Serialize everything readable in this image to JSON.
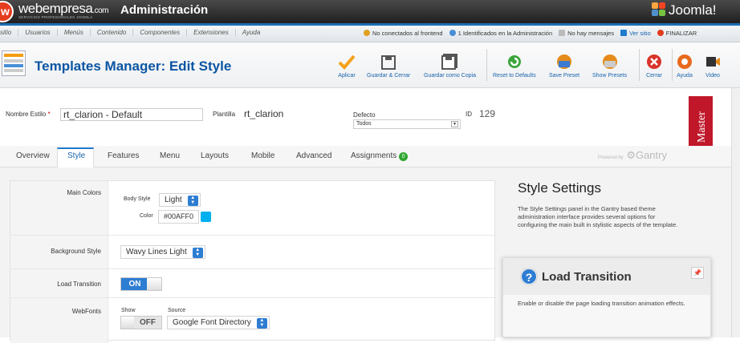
{
  "topbar": {
    "brand": "webempresa",
    "brand_suffix": ".com",
    "brand_sub": "SERVICIOS PROFESIONALES JOOMLA",
    "title": "Administración",
    "joomla": "Joomla!"
  },
  "menu": [
    "sitio",
    "Usuarios",
    "Menús",
    "Contenido",
    "Componentes",
    "Extensiones",
    "Ayuda"
  ],
  "status": {
    "frontend": "No conectados al frontend",
    "admin": "1 Identificados en la Administración",
    "messages": "No hay mensajes",
    "view_site": "Ver sitio",
    "logout": "FINALIZAR"
  },
  "toolbar": {
    "page_title": "Templates Manager: Edit Style",
    "buttons": [
      {
        "label": "Aplicar",
        "icon": "check-icon"
      },
      {
        "label": "Guardar & Cerrar",
        "icon": "save-icon"
      },
      {
        "label": "Guardar como Copia",
        "icon": "save-copy-icon"
      },
      {
        "label": "Reset to Defaults",
        "icon": "reset-icon"
      },
      {
        "label": "Save Preset",
        "icon": "save-preset-icon"
      },
      {
        "label": "Show Presets",
        "icon": "presets-icon"
      },
      {
        "label": "Cerrar",
        "icon": "close-icon"
      },
      {
        "label": "Ayuda",
        "icon": "help-icon"
      },
      {
        "label": "Video",
        "icon": "video-icon"
      }
    ]
  },
  "form": {
    "style_name_label": "Nombre Estilo",
    "required_mark": "*",
    "style_name": "rt_clarion - Default",
    "template_label": "Plantilla",
    "template": "rt_clarion",
    "default_label": "Defecto",
    "default_value": "Todos",
    "id_label": "ID",
    "id": "129",
    "master": "Master"
  },
  "tabs": [
    {
      "label": "Overview"
    },
    {
      "label": "Style"
    },
    {
      "label": "Features"
    },
    {
      "label": "Menu"
    },
    {
      "label": "Layouts"
    },
    {
      "label": "Mobile"
    },
    {
      "label": "Advanced"
    },
    {
      "label": "Assignments"
    }
  ],
  "tabs_badge": "0",
  "active_tab": "Style",
  "gantry": {
    "powered": "Powered by",
    "name": "Gantry"
  },
  "settings": {
    "main_colors": {
      "label": "Main Colors",
      "body_style_label": "Body Style",
      "body_style": "Light",
      "color_label": "Color",
      "color": "#00AFF0"
    },
    "background": {
      "label": "Background Style",
      "value": "Wavy Lines Light"
    },
    "load_transition": {
      "label": "Load Transition",
      "value": "ON"
    },
    "webfonts": {
      "label": "WebFonts",
      "show_label": "Show",
      "show": "OFF",
      "source_label": "Source",
      "source": "Google Font Directory"
    }
  },
  "sidebar": {
    "title": "Style Settings",
    "text": "The Style Settings panel in the Gantry based theme administration interface provides several options for configuring the main built in stylistic aspects of the template.",
    "box_title": "Load Transition",
    "box_text": "Enable or disable the page loading transition animation effects."
  },
  "colors": {
    "accent": "#2d7dd2",
    "title_blue": "#0b55a3",
    "master": "#c0172a",
    "swatch": "#00AFF0"
  }
}
